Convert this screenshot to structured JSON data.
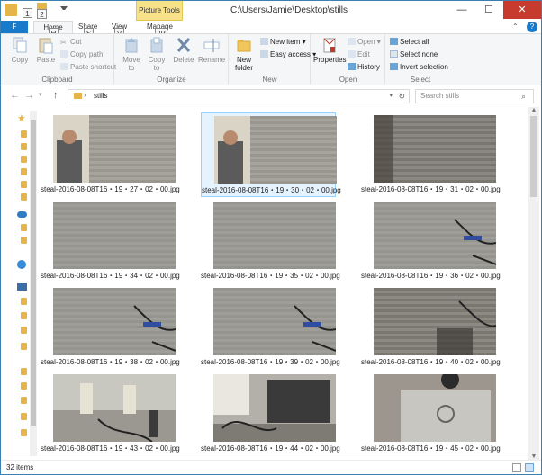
{
  "window": {
    "title": "C:\\Users\\Jamie\\Desktop\\stills",
    "context_tab": "Picture Tools",
    "controls": {
      "minimize": "—",
      "maximize": "☐",
      "close": "✕"
    },
    "qat_keys": [
      "1",
      "2"
    ]
  },
  "tabs": {
    "file": "F",
    "home": "Home",
    "home_key": "H",
    "share": "Share",
    "share_key": "S",
    "view": "View",
    "view_key": "V",
    "manage": "Manage",
    "manage_key": "JP"
  },
  "ribbon": {
    "clipboard": {
      "label": "Clipboard",
      "copy": "Copy",
      "paste": "Paste",
      "cut": "Cut",
      "copy_path": "Copy path",
      "paste_shortcut": "Paste shortcut"
    },
    "organize": {
      "label": "Organize",
      "move_to": "Move to",
      "copy_to": "Copy to",
      "delete": "Delete",
      "rename": "Rename"
    },
    "new": {
      "label": "New",
      "new_folder": "New folder",
      "new_item": "New item",
      "easy_access": "Easy access"
    },
    "open": {
      "label": "Open",
      "properties": "Properties",
      "open": "Open",
      "edit": "Edit",
      "history": "History"
    },
    "select": {
      "label": "Select",
      "select_all": "Select all",
      "select_none": "Select none",
      "invert_selection": "Invert selection"
    }
  },
  "address": {
    "path": "stills",
    "search_placeholder": "Search stills"
  },
  "files": [
    {
      "name": "steal-2016-08-08T16・19・27・02・00.jpg",
      "scene": "blinds-person"
    },
    {
      "name": "steal-2016-08-08T16・19・30・02・00.jpg",
      "scene": "blinds-person",
      "selected": true
    },
    {
      "name": "steal-2016-08-08T16・19・31・02・00.jpg",
      "scene": "blinds-dark"
    },
    {
      "name": "steal-2016-08-08T16・19・34・02・00.jpg",
      "scene": "blinds"
    },
    {
      "name": "steal-2016-08-08T16・19・35・02・00.jpg",
      "scene": "blinds"
    },
    {
      "name": "steal-2016-08-08T16・19・36・02・00.jpg",
      "scene": "blinds-cable"
    },
    {
      "name": "steal-2016-08-08T16・19・38・02・00.jpg",
      "scene": "blinds-cable"
    },
    {
      "name": "steal-2016-08-08T16・19・39・02・00.jpg",
      "scene": "blinds-cable"
    },
    {
      "name": "steal-2016-08-08T16・19・40・02・00.jpg",
      "scene": "blinds-cable-dark"
    },
    {
      "name": "steal-2016-08-08T16・19・43・02・00.jpg",
      "scene": "office"
    },
    {
      "name": "steal-2016-08-08T16・19・44・02・00.jpg",
      "scene": "desk"
    },
    {
      "name": "steal-2016-08-08T16・19・45・02・00.jpg",
      "scene": "laptop"
    }
  ],
  "status": {
    "item_count": "32 items"
  }
}
